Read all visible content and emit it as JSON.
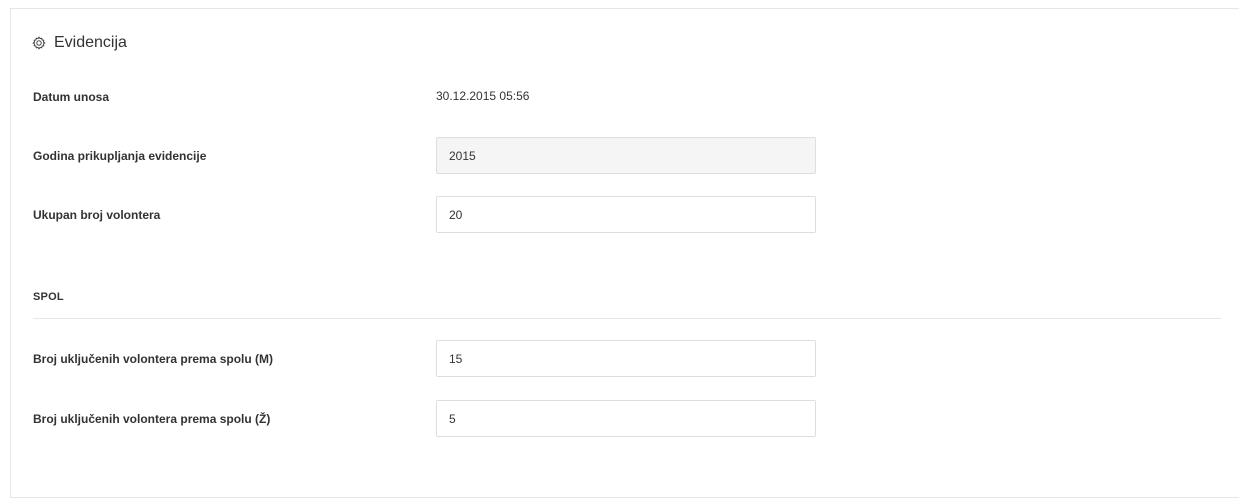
{
  "panel": {
    "title": "Evidencija",
    "icon": "gear-icon"
  },
  "form": {
    "entry_date": {
      "label": "Datum unosa",
      "value": "30.12.2015 05:56"
    },
    "collection_year": {
      "label": "Godina prikupljanja evidencije",
      "value": "2015"
    },
    "total_volunteers": {
      "label": "Ukupan broj volontera",
      "value": "20"
    }
  },
  "gender_section": {
    "heading": "SPOL",
    "male": {
      "label": "Broj uključenih volontera prema spolu (M)",
      "value": "15"
    },
    "female": {
      "label": "Broj uključenih volontera prema spolu (Ž)",
      "value": "5"
    }
  }
}
